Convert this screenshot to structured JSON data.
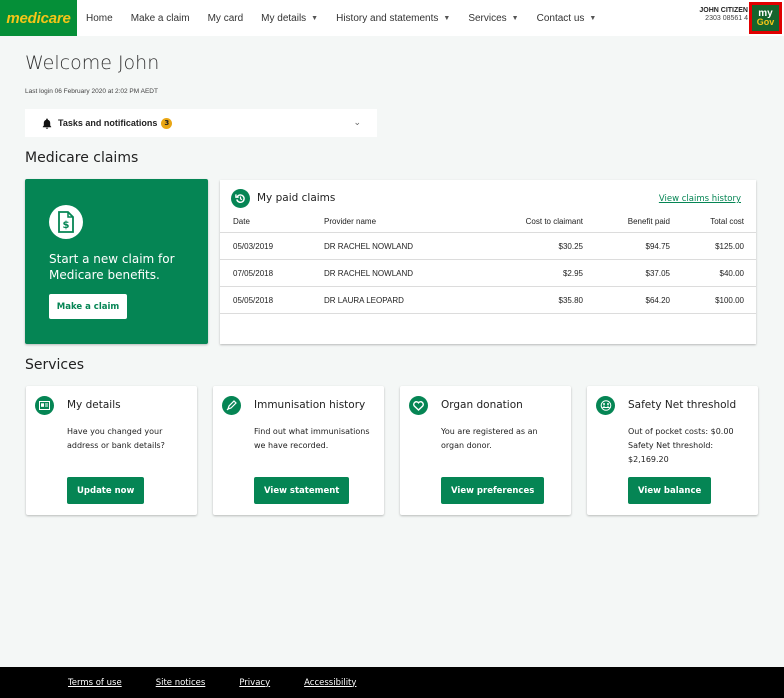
{
  "header": {
    "logo_text": "medicare",
    "nav": [
      {
        "label": "Home",
        "dropdown": false
      },
      {
        "label": "Make a claim",
        "dropdown": false
      },
      {
        "label": "My card",
        "dropdown": false
      },
      {
        "label": "My details",
        "dropdown": true
      },
      {
        "label": "History and statements",
        "dropdown": true
      },
      {
        "label": "Services",
        "dropdown": true
      },
      {
        "label": "Contact us",
        "dropdown": true
      }
    ],
    "user_name": "JOHN CITIZEN",
    "user_number": "2303 08561 4",
    "mygov_top": "my",
    "mygov_bottom": "Gov"
  },
  "welcome": {
    "title": "Welcome John",
    "last_login": "Last login 06 February 2020 at 2:02 PM AEDT"
  },
  "tasks": {
    "label": "Tasks and notifications",
    "count": "3"
  },
  "claims_section": {
    "title": "Medicare claims",
    "new_claim_text": "Start a new claim for Medicare benefits.",
    "new_claim_button": "Make a claim",
    "paid_title": "My paid claims",
    "history_link": "View claims history",
    "columns": [
      "Date",
      "Provider name",
      "Cost to claimant",
      "Benefit paid",
      "Total cost"
    ],
    "rows": [
      [
        "05/03/2019",
        "DR RACHEL NOWLAND",
        "$30.25",
        "$94.75",
        "$125.00"
      ],
      [
        "07/05/2018",
        "DR RACHEL NOWLAND",
        "$2.95",
        "$37.05",
        "$40.00"
      ],
      [
        "05/05/2018",
        "DR LAURA LEOPARD",
        "$35.80",
        "$64.20",
        "$100.00"
      ]
    ]
  },
  "services": {
    "title": "Services",
    "cards": [
      {
        "title": "My details",
        "desc": "Have you changed your address or bank details?",
        "button": "Update now",
        "icon": "id-card-icon"
      },
      {
        "title": "Immunisation history",
        "desc": "Find out what immunisations we have recorded.",
        "button": "View statement",
        "icon": "syringe-icon"
      },
      {
        "title": "Organ donation",
        "desc": "You are registered as an organ donor.",
        "button": "View preferences",
        "icon": "heart-icon"
      },
      {
        "title": "Safety Net threshold",
        "desc_line1": "Out of pocket costs: $0.00",
        "desc_line2": "Safety Net threshold: $2,169.20",
        "button": "View balance",
        "icon": "safety-net-icon"
      }
    ]
  },
  "footer": {
    "links": [
      "Terms of use",
      "Site notices",
      "Privacy",
      "Accessibility"
    ]
  },
  "colors": {
    "brand_green": "#058f38",
    "accent_green": "#058554",
    "logo_yellow": "#f5c518",
    "badge_amber": "#e9a615"
  }
}
